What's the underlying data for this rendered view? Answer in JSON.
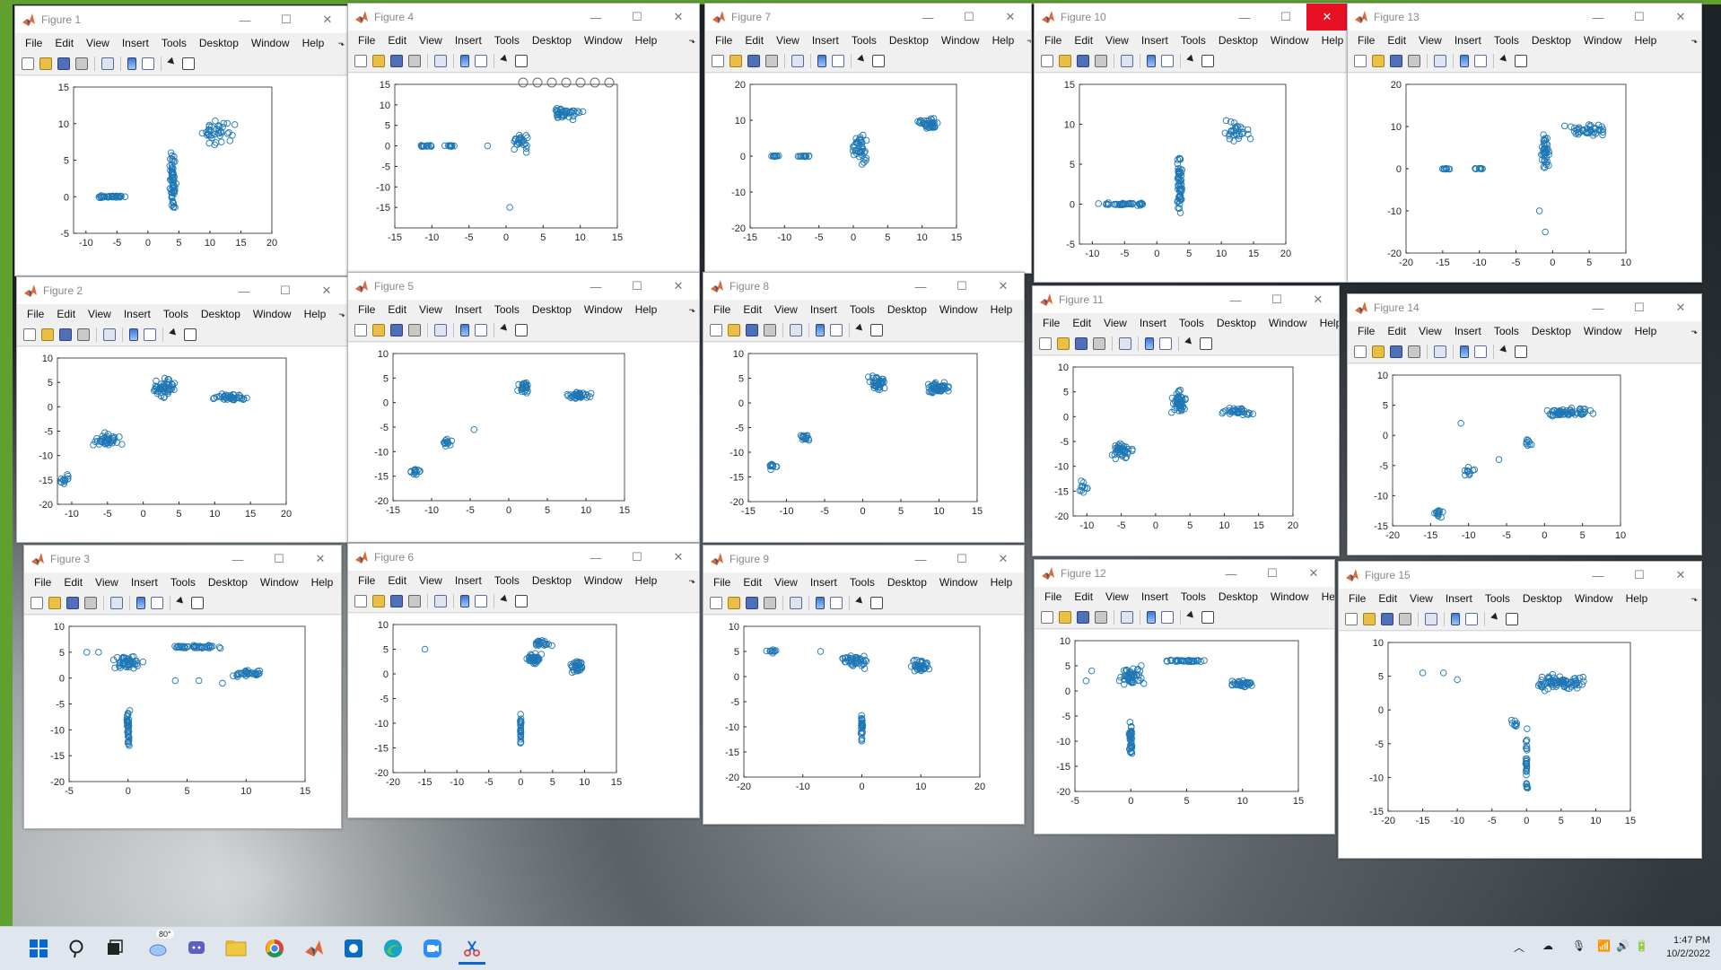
{
  "menu": [
    "File",
    "Edit",
    "View",
    "Insert",
    "Tools",
    "Desktop",
    "Window",
    "Help"
  ],
  "menu_more": "⬎",
  "window_controls": {
    "minimize": "—",
    "maximize": "☐",
    "close": "✕"
  },
  "colors": {
    "marker": "#1f77b4",
    "matlab_green": "#5fa02e",
    "close_hot": "#e81123"
  },
  "figures": [
    {
      "title": "Figure 1",
      "xlim": [
        -12,
        20
      ],
      "ylim": [
        -5,
        15
      ],
      "xticks": [
        -10,
        -5,
        0,
        5,
        10,
        15,
        20
      ],
      "yticks": [
        -5,
        0,
        5,
        10,
        15
      ]
    },
    {
      "title": "Figure 4",
      "xlim": [
        -15,
        15
      ],
      "ylim": [
        -20,
        15
      ],
      "xticks": [
        -15,
        -10,
        -5,
        0,
        5,
        10,
        15
      ],
      "yticks": [
        -15,
        -10,
        -5,
        0,
        5,
        10,
        15
      ],
      "axes_toolbar": true
    },
    {
      "title": "Figure 7",
      "xlim": [
        -15,
        15
      ],
      "ylim": [
        -20,
        20
      ],
      "xticks": [
        -15,
        -10,
        -5,
        0,
        5,
        10,
        15
      ],
      "yticks": [
        -20,
        -10,
        0,
        10,
        20
      ]
    },
    {
      "title": "Figure 10",
      "xlim": [
        -12,
        20
      ],
      "ylim": [
        -5,
        15
      ],
      "xticks": [
        -10,
        -5,
        0,
        5,
        10,
        15,
        20
      ],
      "yticks": [
        -5,
        0,
        5,
        10,
        15
      ],
      "close_hot": true
    },
    {
      "title": "Figure 13",
      "xlim": [
        -20,
        10
      ],
      "ylim": [
        -20,
        20
      ],
      "xticks": [
        -20,
        -15,
        -10,
        -5,
        0,
        5,
        10
      ],
      "yticks": [
        -20,
        -10,
        0,
        10,
        20
      ]
    },
    {
      "title": "Figure 2",
      "xlim": [
        -12,
        20
      ],
      "ylim": [
        -20,
        10
      ],
      "xticks": [
        -10,
        -5,
        0,
        5,
        10,
        15,
        20
      ],
      "yticks": [
        -20,
        -15,
        -10,
        -5,
        0,
        5,
        10
      ]
    },
    {
      "title": "Figure 5",
      "xlim": [
        -15,
        15
      ],
      "ylim": [
        -20,
        10
      ],
      "xticks": [
        -15,
        -10,
        -5,
        0,
        5,
        10,
        15
      ],
      "yticks": [
        -20,
        -15,
        -10,
        -5,
        0,
        5,
        10
      ]
    },
    {
      "title": "Figure 8",
      "xlim": [
        -15,
        15
      ],
      "ylim": [
        -20,
        10
      ],
      "xticks": [
        -15,
        -10,
        -5,
        0,
        5,
        10,
        15
      ],
      "yticks": [
        -20,
        -15,
        -10,
        -5,
        0,
        5,
        10
      ]
    },
    {
      "title": "Figure 11",
      "xlim": [
        -12,
        20
      ],
      "ylim": [
        -20,
        10
      ],
      "xticks": [
        -10,
        -5,
        0,
        5,
        10,
        15,
        20
      ],
      "yticks": [
        -20,
        -15,
        -10,
        -5,
        0,
        5,
        10
      ]
    },
    {
      "title": "Figure 14",
      "xlim": [
        -20,
        10
      ],
      "ylim": [
        -15,
        10
      ],
      "xticks": [
        -20,
        -15,
        -10,
        -5,
        0,
        5,
        10
      ],
      "yticks": [
        -15,
        -10,
        -5,
        0,
        5,
        10
      ]
    },
    {
      "title": "Figure 3",
      "xlim": [
        -5,
        15
      ],
      "ylim": [
        -20,
        10
      ],
      "xticks": [
        -5,
        0,
        5,
        10,
        15
      ],
      "yticks": [
        -20,
        -15,
        -10,
        -5,
        0,
        5,
        10
      ]
    },
    {
      "title": "Figure 6",
      "xlim": [
        -20,
        15
      ],
      "ylim": [
        -20,
        10
      ],
      "xticks": [
        -20,
        -15,
        -10,
        -5,
        0,
        5,
        10,
        15
      ],
      "yticks": [
        -20,
        -15,
        -10,
        -5,
        0,
        5,
        10
      ]
    },
    {
      "title": "Figure 9",
      "xlim": [
        -20,
        20
      ],
      "ylim": [
        -20,
        10
      ],
      "xticks": [
        -20,
        -10,
        0,
        10,
        20
      ],
      "yticks": [
        -20,
        -15,
        -10,
        -5,
        0,
        5,
        10
      ]
    },
    {
      "title": "Figure 12",
      "xlim": [
        -5,
        15
      ],
      "ylim": [
        -20,
        10
      ],
      "xticks": [
        -5,
        0,
        5,
        10,
        15
      ],
      "yticks": [
        -20,
        -15,
        -10,
        -5,
        0,
        5,
        10
      ]
    },
    {
      "title": "Figure 15",
      "xlim": [
        -20,
        15
      ],
      "ylim": [
        -15,
        10
      ],
      "xticks": [
        -20,
        -15,
        -10,
        -5,
        0,
        5,
        10,
        15
      ],
      "yticks": [
        -15,
        -10,
        -5,
        0,
        5,
        10
      ]
    }
  ],
  "chart_data": [
    {
      "type": "scatter",
      "figure": "Figure 1",
      "xlim": [
        -12,
        20
      ],
      "ylim": [
        -5,
        15
      ],
      "clusters": [
        {
          "cx": -6,
          "cy": 0,
          "spread": [
            5,
            0.2
          ],
          "n": 40
        },
        {
          "cx": 4,
          "cy": 2,
          "spread": [
            0.6,
            5
          ],
          "n": 60
        },
        {
          "cx": 11,
          "cy": 9,
          "spread": [
            4,
            2
          ],
          "n": 40
        }
      ]
    },
    {
      "type": "scatter",
      "figure": "Figure 4",
      "xlim": [
        -15,
        15
      ],
      "ylim": [
        -20,
        15
      ],
      "clusters": [
        {
          "cx": -11,
          "cy": 0,
          "spread": [
            1.2,
            0.2
          ],
          "n": 15
        },
        {
          "cx": -7.5,
          "cy": 0,
          "spread": [
            1,
            0.2
          ],
          "n": 15
        },
        {
          "cx": 2,
          "cy": 1,
          "spread": [
            1.5,
            3
          ],
          "n": 25
        },
        {
          "cx": 8,
          "cy": 8,
          "spread": [
            3,
            2
          ],
          "n": 40
        }
      ],
      "points": [
        [
          -2.5,
          0
        ],
        [
          0.5,
          -15
        ]
      ]
    },
    {
      "type": "scatter",
      "figure": "Figure 7",
      "xlim": [
        -15,
        15
      ],
      "ylim": [
        -20,
        20
      ],
      "clusters": [
        {
          "cx": -11.5,
          "cy": 0,
          "spread": [
            0.8,
            0.2
          ],
          "n": 10
        },
        {
          "cx": -7,
          "cy": 0,
          "spread": [
            1.2,
            0.2
          ],
          "n": 15
        },
        {
          "cx": 1,
          "cy": 2,
          "spread": [
            1.5,
            6
          ],
          "n": 40
        },
        {
          "cx": 11,
          "cy": 9,
          "spread": [
            2,
            2
          ],
          "n": 40
        }
      ]
    },
    {
      "type": "scatter",
      "figure": "Figure 10",
      "xlim": [
        -12,
        20
      ],
      "ylim": [
        -5,
        15
      ],
      "clusters": [
        {
          "cx": -5,
          "cy": 0,
          "spread": [
            5,
            0.2
          ],
          "n": 40
        },
        {
          "cx": 3.5,
          "cy": 2,
          "spread": [
            0.6,
            5
          ],
          "n": 60
        },
        {
          "cx": 12,
          "cy": 9,
          "spread": [
            3,
            2
          ],
          "n": 30
        }
      ]
    },
    {
      "type": "scatter",
      "figure": "Figure 13",
      "xlim": [
        -20,
        10
      ],
      "ylim": [
        -20,
        20
      ],
      "clusters": [
        {
          "cx": -14.5,
          "cy": 0,
          "spread": [
            1,
            0.2
          ],
          "n": 10
        },
        {
          "cx": -10,
          "cy": 0,
          "spread": [
            1,
            0.2
          ],
          "n": 10
        },
        {
          "cx": -1,
          "cy": 4,
          "spread": [
            0.8,
            6
          ],
          "n": 40
        },
        {
          "cx": 5,
          "cy": 9,
          "spread": [
            4,
            2
          ],
          "n": 40
        }
      ],
      "points": [
        [
          -1.8,
          -10
        ],
        [
          -1,
          -15
        ]
      ]
    },
    {
      "type": "scatter",
      "figure": "Figure 2",
      "xlim": [
        -12,
        20
      ],
      "ylim": [
        -20,
        10
      ],
      "clusters": [
        {
          "cx": -11,
          "cy": -15,
          "spread": [
            0.8,
            1.5
          ],
          "n": 12
        },
        {
          "cx": -5,
          "cy": -7,
          "spread": [
            2.5,
            2
          ],
          "n": 40
        },
        {
          "cx": 3,
          "cy": 4,
          "spread": [
            2,
            2.5
          ],
          "n": 50
        },
        {
          "cx": 12,
          "cy": 2,
          "spread": [
            3,
            1
          ],
          "n": 40
        }
      ]
    },
    {
      "type": "scatter",
      "figure": "Figure 5",
      "xlim": [
        -15,
        15
      ],
      "ylim": [
        -20,
        10
      ],
      "clusters": [
        {
          "cx": -12,
          "cy": -14,
          "spread": [
            1,
            1
          ],
          "n": 15
        },
        {
          "cx": -8,
          "cy": -8,
          "spread": [
            1,
            1
          ],
          "n": 15
        },
        {
          "cx": 2,
          "cy": 3,
          "spread": [
            1,
            2
          ],
          "n": 25
        },
        {
          "cx": 9,
          "cy": 1.5,
          "spread": [
            2,
            1
          ],
          "n": 40
        }
      ],
      "points": [
        [
          -4.5,
          -5.5
        ]
      ]
    },
    {
      "type": "scatter",
      "figure": "Figure 8",
      "xlim": [
        -15,
        15
      ],
      "ylim": [
        -20,
        10
      ],
      "clusters": [
        {
          "cx": -12,
          "cy": -13,
          "spread": [
            1,
            1.5
          ],
          "n": 10
        },
        {
          "cx": -7.5,
          "cy": -7,
          "spread": [
            1,
            1
          ],
          "n": 15
        },
        {
          "cx": 2,
          "cy": 4,
          "spread": [
            1.5,
            2
          ],
          "n": 40
        },
        {
          "cx": 10,
          "cy": 3,
          "spread": [
            2,
            1.5
          ],
          "n": 50
        }
      ]
    },
    {
      "type": "scatter",
      "figure": "Figure 11",
      "xlim": [
        -12,
        20
      ],
      "ylim": [
        -20,
        10
      ],
      "clusters": [
        {
          "cx": -10.5,
          "cy": -14,
          "spread": [
            1,
            2
          ],
          "n": 12
        },
        {
          "cx": -5,
          "cy": -7,
          "spread": [
            2,
            2
          ],
          "n": 40
        },
        {
          "cx": 3.5,
          "cy": 3,
          "spread": [
            1.5,
            3
          ],
          "n": 50
        },
        {
          "cx": 12,
          "cy": 1,
          "spread": [
            3,
            1
          ],
          "n": 35
        }
      ]
    },
    {
      "type": "scatter",
      "figure": "Figure 14",
      "xlim": [
        -20,
        10
      ],
      "ylim": [
        -15,
        10
      ],
      "clusters": [
        {
          "cx": -14,
          "cy": -13,
          "spread": [
            1,
            1
          ],
          "n": 12
        },
        {
          "cx": -10,
          "cy": -6,
          "spread": [
            1,
            1
          ],
          "n": 12
        },
        {
          "cx": 3,
          "cy": 4,
          "spread": [
            4,
            1
          ],
          "n": 60
        },
        {
          "cx": -2,
          "cy": -1,
          "spread": [
            1,
            1
          ],
          "n": 8
        }
      ],
      "points": [
        [
          -11,
          2
        ],
        [
          -6,
          -4
        ]
      ]
    },
    {
      "type": "scatter",
      "figure": "Figure 3",
      "xlim": [
        -5,
        15
      ],
      "ylim": [
        -20,
        10
      ],
      "clusters": [
        {
          "cx": 0,
          "cy": 3,
          "spread": [
            1.5,
            2
          ],
          "n": 50
        },
        {
          "cx": 0,
          "cy": -10,
          "spread": [
            0.2,
            6
          ],
          "n": 40
        },
        {
          "cx": 5.5,
          "cy": 6,
          "spread": [
            3.5,
            0.4
          ],
          "n": 40
        },
        {
          "cx": 10,
          "cy": 1,
          "spread": [
            1.5,
            1
          ],
          "n": 35
        }
      ],
      "points": [
        [
          -3.5,
          5
        ],
        [
          -2.5,
          5
        ],
        [
          4,
          -0.5
        ],
        [
          6,
          -0.5
        ],
        [
          8,
          -1
        ]
      ]
    },
    {
      "type": "scatter",
      "figure": "Figure 6",
      "xlim": [
        -20,
        15
      ],
      "ylim": [
        -20,
        10
      ],
      "clusters": [
        {
          "cx": 2,
          "cy": 3,
          "spread": [
            1.5,
            1.5
          ],
          "n": 40
        },
        {
          "cx": 3.5,
          "cy": 6,
          "spread": [
            2,
            1
          ],
          "n": 20
        },
        {
          "cx": 9,
          "cy": 1.5,
          "spread": [
            1.5,
            1.5
          ],
          "n": 35
        },
        {
          "cx": 0,
          "cy": -11,
          "spread": [
            0.1,
            4
          ],
          "n": 25
        }
      ],
      "points": [
        [
          -15,
          5
        ]
      ]
    },
    {
      "type": "scatter",
      "figure": "Figure 9",
      "xlim": [
        -20,
        20
      ],
      "ylim": [
        -20,
        10
      ],
      "clusters": [
        {
          "cx": -15,
          "cy": 5,
          "spread": [
            2,
            0.5
          ],
          "n": 10
        },
        {
          "cx": -1,
          "cy": 3,
          "spread": [
            3,
            2
          ],
          "n": 40
        },
        {
          "cx": 10,
          "cy": 2,
          "spread": [
            2,
            2
          ],
          "n": 40
        },
        {
          "cx": 0,
          "cy": -10,
          "spread": [
            0.2,
            4
          ],
          "n": 25
        }
      ],
      "points": [
        [
          -7,
          5
        ]
      ]
    },
    {
      "type": "scatter",
      "figure": "Figure 12",
      "xlim": [
        -5,
        15
      ],
      "ylim": [
        -20,
        10
      ],
      "clusters": [
        {
          "cx": 0,
          "cy": 3,
          "spread": [
            1.5,
            2.5
          ],
          "n": 50
        },
        {
          "cx": 0,
          "cy": -10,
          "spread": [
            0.2,
            6
          ],
          "n": 35
        },
        {
          "cx": 5,
          "cy": 6,
          "spread": [
            3,
            0.3
          ],
          "n": 35
        },
        {
          "cx": 10,
          "cy": 1.5,
          "spread": [
            1.5,
            1
          ],
          "n": 35
        }
      ],
      "points": [
        [
          -3.5,
          4
        ],
        [
          -4,
          2
        ]
      ]
    },
    {
      "type": "scatter",
      "figure": "Figure 15",
      "xlim": [
        -20,
        15
      ],
      "ylim": [
        -15,
        10
      ],
      "clusters": [
        {
          "cx": 5,
          "cy": 4,
          "spread": [
            5,
            1.5
          ],
          "n": 80
        },
        {
          "cx": 0,
          "cy": -8,
          "spread": [
            0.2,
            6
          ],
          "n": 30
        },
        {
          "cx": -2,
          "cy": -2,
          "spread": [
            1.5,
            1
          ],
          "n": 8
        }
      ],
      "points": [
        [
          -15,
          5.5
        ],
        [
          -12,
          5.5
        ],
        [
          -10,
          4.5
        ]
      ]
    }
  ],
  "taskbar": {
    "weather": "80°",
    "time": "1:47 PM",
    "date": "10/2/2022"
  }
}
